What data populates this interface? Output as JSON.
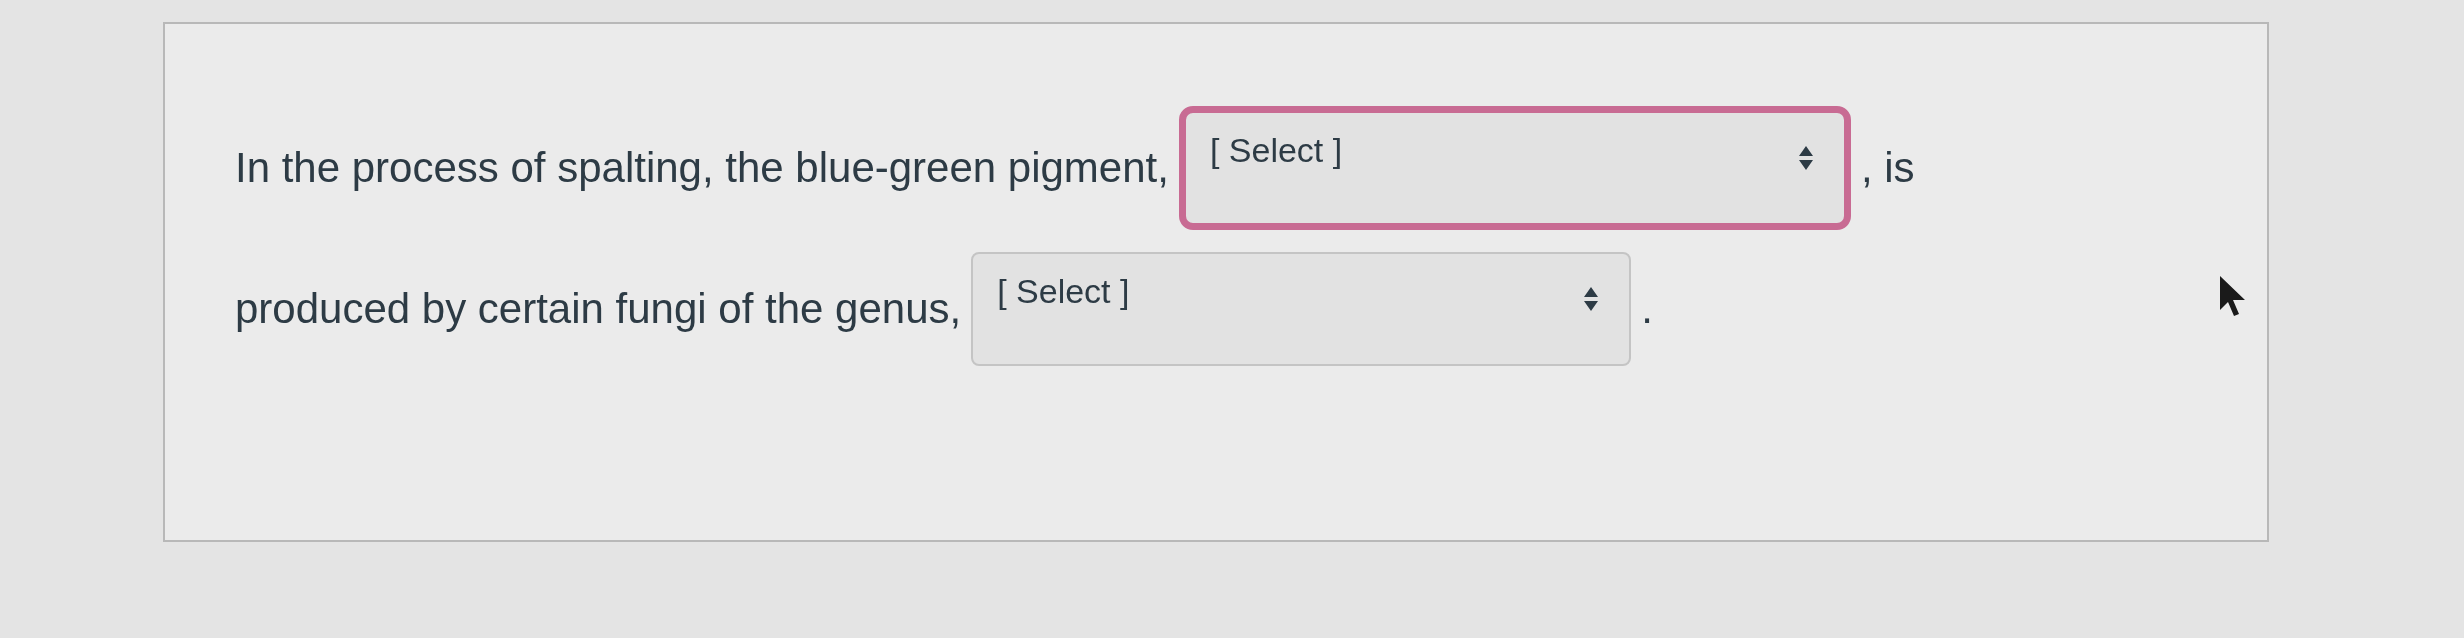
{
  "question": {
    "lines": [
      {
        "parts": [
          {
            "kind": "text",
            "text": "In the process of spalting, the blue-green pigment,"
          },
          {
            "kind": "select",
            "value": "[ Select ]",
            "focused": true
          },
          {
            "kind": "text",
            "text": ", is"
          }
        ]
      },
      {
        "parts": [
          {
            "kind": "text",
            "text": "produced by certain fungi of the genus,"
          },
          {
            "kind": "select",
            "value": "[ Select ]",
            "focused": false
          },
          {
            "kind": "text",
            "text": "."
          }
        ]
      }
    ]
  }
}
